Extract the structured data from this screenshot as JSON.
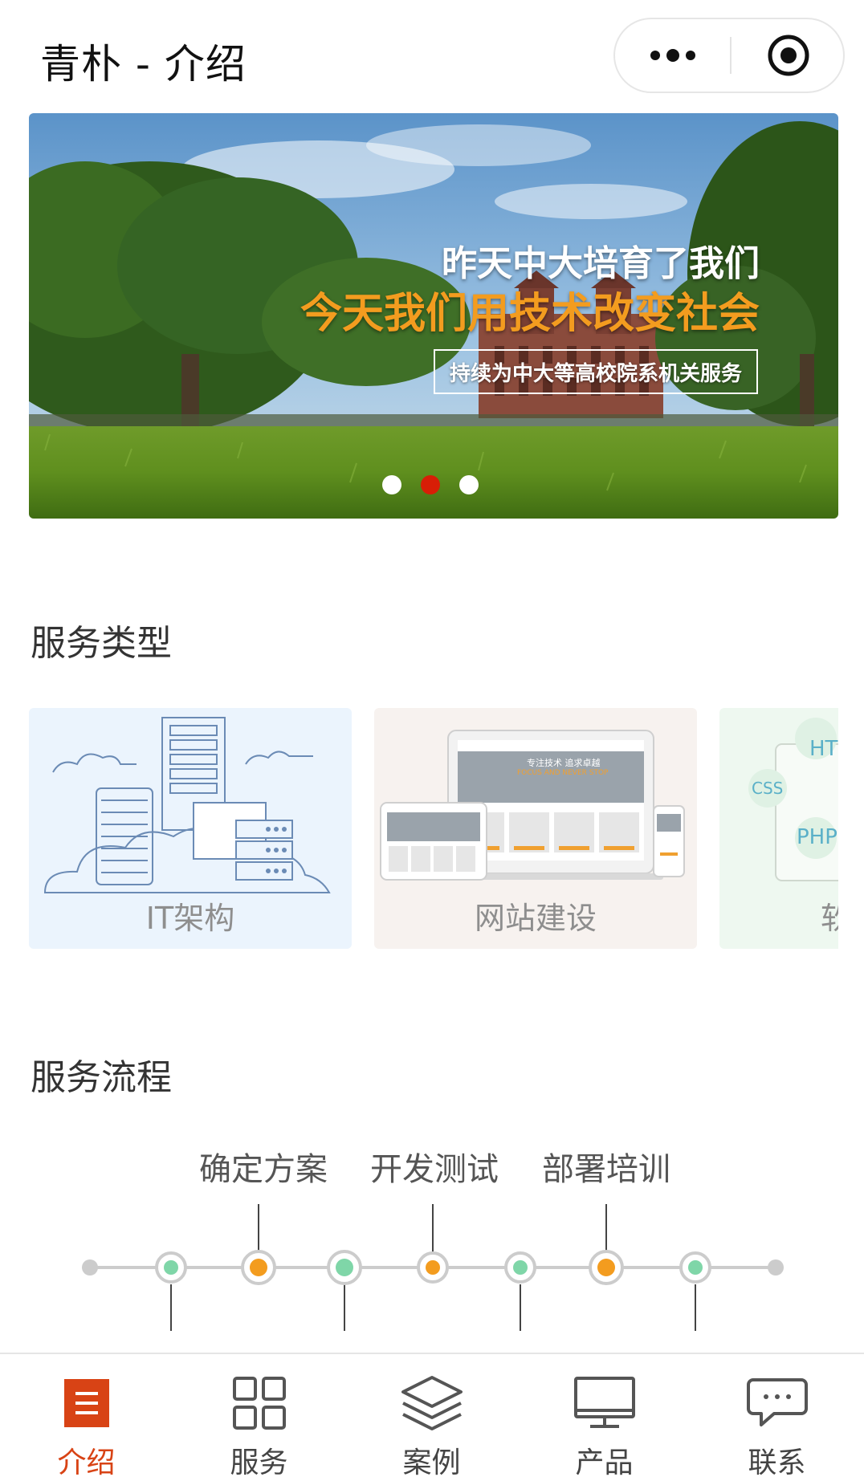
{
  "header": {
    "title": "青朴 - 介绍",
    "more_icon": "more-dots-icon",
    "close_icon": "target-close-icon"
  },
  "banner": {
    "line1": "昨天中大培育了我们",
    "line2": "今天我们用技术改变社会",
    "boxed_text": "持续为中大等高校院系机关服务",
    "indicator": {
      "count": 3,
      "active_index": 1
    },
    "colors": {
      "highlight": "#f39c1f",
      "active_dot": "#d81e06"
    }
  },
  "services": {
    "title": "服务类型",
    "cards": [
      {
        "label": "IT架构",
        "icon": "server-cloud-icon"
      },
      {
        "label": "网站建设",
        "icon": "responsive-devices-icon"
      },
      {
        "label": "软",
        "icon": "web-tech-icon",
        "tags": [
          "HTML",
          "CSS",
          "PHP"
        ]
      }
    ],
    "mockup_text": {
      "slogan": "专注技术 追求卓越",
      "slogan_en": "FOCUS AND NEVER STOP"
    }
  },
  "process": {
    "title": "服务流程",
    "steps": [
      "确定方案",
      "开发测试",
      "部署培训"
    ],
    "colors": {
      "primary": "#f39c1f",
      "secondary": "#7fd6a8",
      "line": "#cccccc"
    }
  },
  "tabbar": {
    "items": [
      {
        "label": "介绍",
        "icon": "intro-icon",
        "active": true
      },
      {
        "label": "服务",
        "icon": "grid-icon",
        "active": false
      },
      {
        "label": "案例",
        "icon": "layers-icon",
        "active": false
      },
      {
        "label": "产品",
        "icon": "monitor-icon",
        "active": false
      },
      {
        "label": "联系",
        "icon": "chat-icon",
        "active": false
      }
    ],
    "active_color": "#d84315"
  }
}
